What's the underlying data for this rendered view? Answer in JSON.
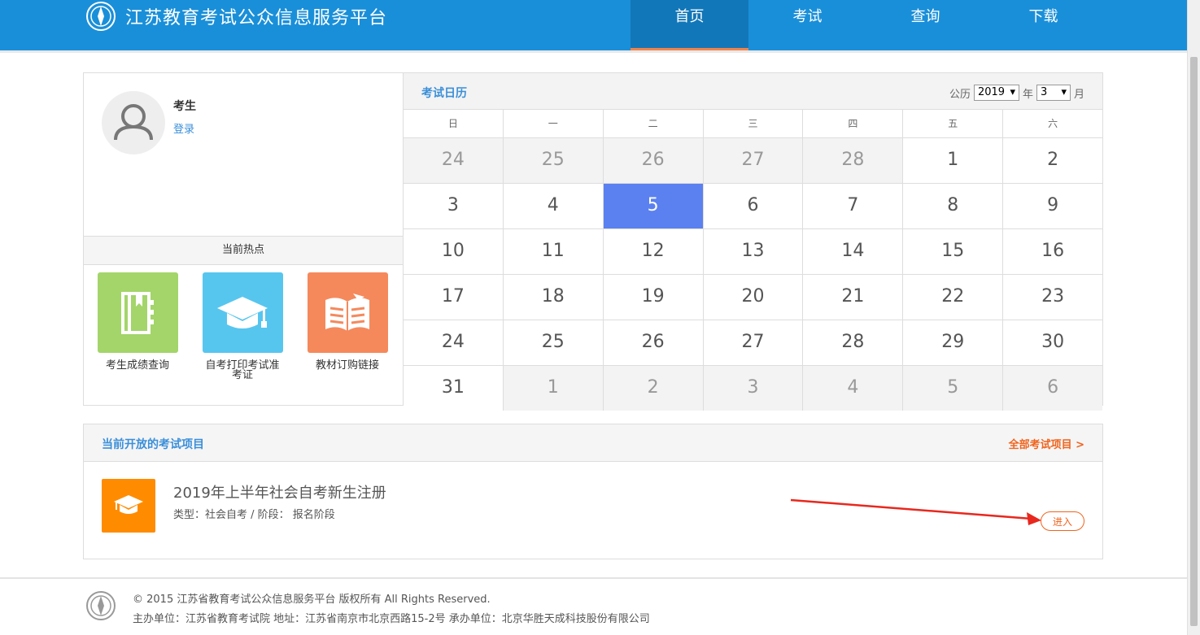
{
  "header": {
    "site_title": "江苏教育考试公众信息服务平台",
    "nav": [
      {
        "label": "首页",
        "active": true
      },
      {
        "label": "考试",
        "active": false
      },
      {
        "label": "查询",
        "active": false
      },
      {
        "label": "下载",
        "active": false
      }
    ],
    "brand_color": "#1a8fd9",
    "accent_color": "#f0834b"
  },
  "profile": {
    "name": "考生",
    "login_label": "登录"
  },
  "hot": {
    "title": "当前热点",
    "items": [
      {
        "label": "考生成绩查询",
        "icon": "notebook-icon",
        "color": "#a3d56a"
      },
      {
        "label": "自考打印考试准考证",
        "icon": "graduation-cap-icon",
        "color": "#57c6ef"
      },
      {
        "label": "教材订购链接",
        "icon": "open-book-icon",
        "color": "#f5895c"
      }
    ]
  },
  "calendar": {
    "title": "考试日历",
    "era_label": "公历",
    "year_value": "2019",
    "year_suffix": "年",
    "month_value": "3",
    "month_suffix": "月",
    "weekdays": [
      "日",
      "一",
      "二",
      "三",
      "四",
      "五",
      "六"
    ],
    "weeks": [
      [
        {
          "d": "24",
          "o": true
        },
        {
          "d": "25",
          "o": true
        },
        {
          "d": "26",
          "o": true
        },
        {
          "d": "27",
          "o": true
        },
        {
          "d": "28",
          "o": true
        },
        {
          "d": "1"
        },
        {
          "d": "2"
        }
      ],
      [
        {
          "d": "3"
        },
        {
          "d": "4"
        },
        {
          "d": "5",
          "today": true
        },
        {
          "d": "6"
        },
        {
          "d": "7"
        },
        {
          "d": "8"
        },
        {
          "d": "9"
        }
      ],
      [
        {
          "d": "10"
        },
        {
          "d": "11"
        },
        {
          "d": "12"
        },
        {
          "d": "13"
        },
        {
          "d": "14"
        },
        {
          "d": "15"
        },
        {
          "d": "16"
        }
      ],
      [
        {
          "d": "17"
        },
        {
          "d": "18"
        },
        {
          "d": "19"
        },
        {
          "d": "20"
        },
        {
          "d": "21"
        },
        {
          "d": "22"
        },
        {
          "d": "23"
        }
      ],
      [
        {
          "d": "24"
        },
        {
          "d": "25"
        },
        {
          "d": "26"
        },
        {
          "d": "27"
        },
        {
          "d": "28"
        },
        {
          "d": "29"
        },
        {
          "d": "30"
        }
      ],
      [
        {
          "d": "31"
        },
        {
          "d": "1",
          "o": true
        },
        {
          "d": "2",
          "o": true
        },
        {
          "d": "3",
          "o": true
        },
        {
          "d": "4",
          "o": true
        },
        {
          "d": "5",
          "o": true
        },
        {
          "d": "6",
          "o": true
        }
      ]
    ],
    "today_color": "#5b80f0"
  },
  "exams": {
    "title": "当前开放的考试项目",
    "all_link": "全部考试项目 >",
    "items": [
      {
        "name": "2019年上半年社会自考新生注册",
        "meta": "类型：社会自考 / 阶段： 报名阶段",
        "enter_label": "进入",
        "icon": "graduation-cap-icon"
      }
    ]
  },
  "footer": {
    "copyright": "© 2015 江苏省教育考试公众信息服务平台 版权所有 All Rights Reserved.",
    "org": "主办单位：江苏省教育考试院 地址：江苏省南京市北京西路15-2号 承办单位：北京华胜天成科技股份有限公司"
  }
}
